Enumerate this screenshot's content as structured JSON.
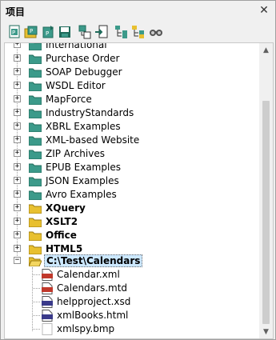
{
  "window": {
    "title": "项目",
    "close_glyph": "✕"
  },
  "toolbar": {
    "buttons": [
      {
        "icon": "new-project-icon"
      },
      {
        "icon": "open-project-icon"
      },
      {
        "icon": "reload-project-icon"
      },
      {
        "icon": "save-project-icon"
      },
      {
        "icon": "add-files-icon"
      },
      {
        "icon": "add-active-file-icon"
      },
      {
        "icon": "add-folder-icon"
      },
      {
        "icon": "add-external-folder-icon"
      },
      {
        "icon": "project-properties-icon"
      }
    ]
  },
  "tree": {
    "partial_top_label": "International",
    "folders": [
      {
        "label": "Purchase Order",
        "bold": false,
        "color": "#3c9a8a"
      },
      {
        "label": "SOAP Debugger",
        "bold": false,
        "color": "#3c9a8a"
      },
      {
        "label": "WSDL Editor",
        "bold": false,
        "color": "#3c9a8a"
      },
      {
        "label": "MapForce",
        "bold": false,
        "color": "#3c9a8a"
      },
      {
        "label": "IndustryStandards",
        "bold": false,
        "color": "#3c9a8a"
      },
      {
        "label": "XBRL Examples",
        "bold": false,
        "color": "#3c9a8a"
      },
      {
        "label": "XML-based Website",
        "bold": false,
        "color": "#3c9a8a"
      },
      {
        "label": "ZIP Archives",
        "bold": false,
        "color": "#3c9a8a"
      },
      {
        "label": "EPUB Examples",
        "bold": false,
        "color": "#3c9a8a"
      },
      {
        "label": "JSON Examples",
        "bold": false,
        "color": "#3c9a8a"
      },
      {
        "label": "Avro Examples",
        "bold": false,
        "color": "#3c9a8a"
      },
      {
        "label": "XQuery",
        "bold": true,
        "color": "#e8c030"
      },
      {
        "label": "XSLT2",
        "bold": true,
        "color": "#e8c030"
      },
      {
        "label": "Office",
        "bold": true,
        "color": "#e8c030"
      },
      {
        "label": "HTML5",
        "bold": true,
        "color": "#e8c030"
      }
    ],
    "expanded_folder": {
      "label": "C:\\Test\\Calendars",
      "color": "#e8c030"
    },
    "files": [
      {
        "label": "Calendar.xml",
        "type": "XML",
        "color": "#c0392b"
      },
      {
        "label": "Calendars.mtd",
        "type": "MTD",
        "color": "#c0392b"
      },
      {
        "label": "helpproject.xsd",
        "type": "XSD",
        "color": "#3a3a8a"
      },
      {
        "label": "xmlBooks.html",
        "type": "HTML",
        "color": "#3a3a8a"
      },
      {
        "label": "xmlspy.bmp",
        "type": "BMP",
        "color": "#ffffff"
      }
    ]
  },
  "colors": {
    "teal_folder": "#3c9a8a",
    "yellow_folder": "#e8c030",
    "selection": "#cce8ff"
  }
}
